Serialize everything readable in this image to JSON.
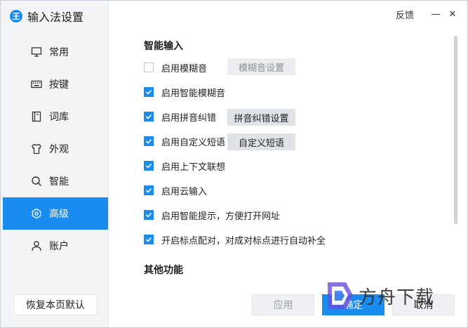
{
  "app": {
    "title": "输入法设置",
    "logo_glyph": "王"
  },
  "titlebar": {
    "feedback": "反馈",
    "minimize_glyph": "—",
    "close_glyph": "✕"
  },
  "sidebar": {
    "items": [
      {
        "label": "常用",
        "icon": "monitor-icon",
        "active": false
      },
      {
        "label": "按键",
        "icon": "keyboard-icon",
        "active": false
      },
      {
        "label": "词库",
        "icon": "book-icon",
        "active": false
      },
      {
        "label": "外观",
        "icon": "shirt-icon",
        "active": false
      },
      {
        "label": "智能",
        "icon": "search-icon",
        "active": false
      },
      {
        "label": "高级",
        "icon": "hexagon-icon",
        "active": true
      },
      {
        "label": "账户",
        "icon": "user-icon",
        "active": false
      }
    ],
    "reset_label": "恢复本页默认"
  },
  "main": {
    "section_smart": "智能输入",
    "options": [
      {
        "label": "启用模糊音",
        "checked": false,
        "button": "模糊音设置",
        "button_enabled": false
      },
      {
        "label": "启用智能模糊音",
        "checked": true
      },
      {
        "label": "启用拼音纠错",
        "checked": true,
        "button": "拼音纠错设置",
        "button_enabled": true
      },
      {
        "label": "启用自定义短语",
        "checked": true,
        "button": "自定义短语",
        "button_enabled": true
      },
      {
        "label": "启用上下文联想",
        "checked": true
      },
      {
        "label": "启用云输入",
        "checked": true
      },
      {
        "label": "启用智能提示，方便打开网址",
        "checked": true
      },
      {
        "label": "开启标点配对，对成对标点进行自动补全",
        "checked": true
      }
    ],
    "section_other": "其他功能"
  },
  "footer": {
    "apply": "应用",
    "ok": "确定",
    "cancel": "取消"
  },
  "watermark": {
    "text": "方舟下载"
  },
  "colors": {
    "accent": "#1a8cf0",
    "sidebar_bg": "#f3f4f6"
  }
}
